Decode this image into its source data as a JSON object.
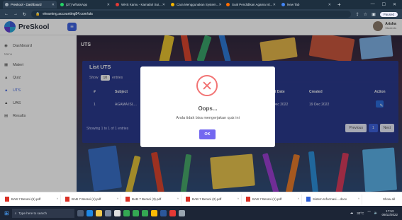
{
  "browser": {
    "tabs": [
      {
        "title": "Preskool - Dashboard",
        "color": "#9aa6b2"
      },
      {
        "title": "(27) WhatsApp",
        "color": "#25d366"
      },
      {
        "title": "WHS Kamu - Kamalah Sui...",
        "color": "#e53935"
      },
      {
        "title": "Cara Menggunakan System...",
        "color": "#f4b400"
      },
      {
        "title": "Soal Pendidikan Agama Isl...",
        "color": "#ff6d00"
      },
      {
        "title": "New Tab",
        "color": "#4285f4"
      }
    ],
    "url": "elearning.accounting84.com/uts",
    "paused_label": "Paused"
  },
  "app": {
    "logo_text": "PreSkool",
    "user_name": "Arisha",
    "user_role": "Students"
  },
  "sidebar": {
    "items": [
      {
        "label": "Dashboard",
        "active": false
      },
      {
        "label": "Menu",
        "small": true
      },
      {
        "label": "Materi",
        "active": false
      },
      {
        "label": "Quiz",
        "active": false
      },
      {
        "label": "UTS",
        "active": true
      },
      {
        "label": "UAS",
        "active": false
      },
      {
        "label": "Results",
        "active": false
      }
    ]
  },
  "main": {
    "page_title": "UTS",
    "card_title": "List UTS",
    "show_label": "Show",
    "show_value": "10",
    "entries_label": "entries",
    "columns": [
      "#",
      "Subject",
      "Start Date",
      "Created",
      "Action"
    ],
    "rows": [
      {
        "no": "1",
        "subject": "AGAMA ISL...",
        "start_date": "19 Dec 2022",
        "created": "19 Dec 2022"
      }
    ],
    "info_text": "Showing 1 to 1 of 1 entries",
    "pager": {
      "prev": "Previous",
      "page": "1",
      "next": "Next"
    }
  },
  "modal": {
    "title": "Oops...",
    "text": "Anda tidak bisa mengerjakan quiz ini",
    "ok_label": "OK",
    "accent": "#7367f0",
    "error_color": "#f27474"
  },
  "downloads": {
    "items": [
      "BAB 7 Berani (5).pdf",
      "BAB 7 Berani (4).pdf",
      "BAB 7 Berani (3).pdf",
      "BAB 7 Berani (2).pdf",
      "BAB 7 Berani (1).pdf",
      "Sistem Informasi....docx"
    ],
    "show_all": "Show all"
  },
  "taskbar": {
    "search_placeholder": "Type here to search",
    "weather": "30°C",
    "time": "17:53",
    "date": "09/12/2022"
  }
}
